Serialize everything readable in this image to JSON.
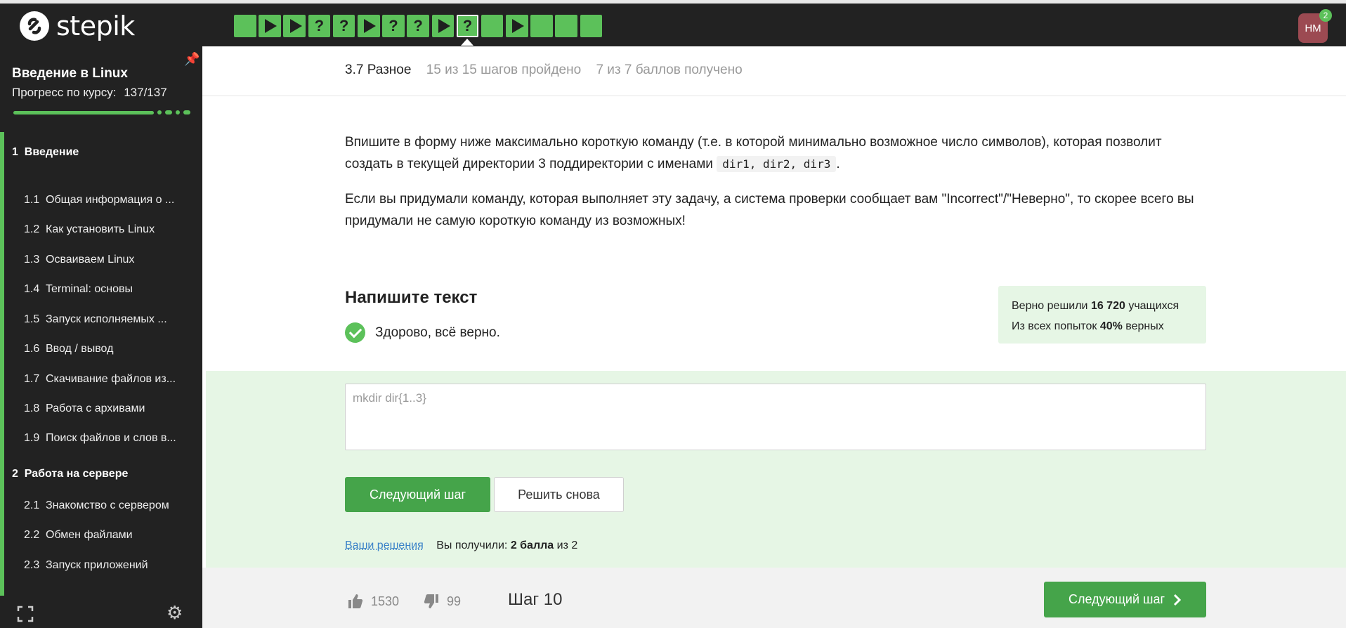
{
  "app": {
    "logo_text": "stepik"
  },
  "steps": [
    {
      "type": "done"
    },
    {
      "type": "video"
    },
    {
      "type": "video"
    },
    {
      "type": "quiz"
    },
    {
      "type": "quiz"
    },
    {
      "type": "video"
    },
    {
      "type": "quiz"
    },
    {
      "type": "quiz"
    },
    {
      "type": "video"
    },
    {
      "type": "quiz",
      "active": true
    },
    {
      "type": "done"
    },
    {
      "type": "video"
    },
    {
      "type": "done"
    },
    {
      "type": "done"
    },
    {
      "type": "done"
    }
  ],
  "user": {
    "initials": "НМ",
    "notifications": "2"
  },
  "sidebar": {
    "course_title": "Введение в Linux",
    "progress_label": "Прогресс по курсу:",
    "progress_value": "137/137",
    "sections": [
      {
        "num": "1",
        "title": "Введение"
      },
      {
        "num": "2",
        "title": "Работа на сервере"
      }
    ],
    "lessons": [
      {
        "num": "1.1",
        "title": "Общая информация о ..."
      },
      {
        "num": "1.2",
        "title": "Как установить Linux"
      },
      {
        "num": "1.3",
        "title": "Осваиваем Linux"
      },
      {
        "num": "1.4",
        "title": "Terminal: основы"
      },
      {
        "num": "1.5",
        "title": "Запуск исполняемых ..."
      },
      {
        "num": "1.6",
        "title": "Ввод / вывод"
      },
      {
        "num": "1.7",
        "title": "Скачивание файлов из..."
      },
      {
        "num": "1.8",
        "title": "Работа с архивами"
      },
      {
        "num": "1.9",
        "title": "Поиск файлов и слов в..."
      },
      {
        "num": "2.1",
        "title": "Знакомство с сервером"
      },
      {
        "num": "2.2",
        "title": "Обмен файлами"
      },
      {
        "num": "2.3",
        "title": "Запуск приложений"
      }
    ]
  },
  "header": {
    "lesson": "3.7 Разное",
    "steps_passed": "15 из 15 шагов пройдено",
    "points": "7 из 7 баллов  получено"
  },
  "content": {
    "p1_before": "Впишите в форму ниже максимально короткую команду (т.е. в которой минимально возможное число символов), которая позволит создать в текущей директории 3 поддиректории с именами ",
    "p1_code": "dir1, dir2, dir3",
    "p1_after": ".",
    "p2": "Если вы придумали команду, которая выполняет эту задачу, а система проверки сообщает вам \"Incorrect\"/\"Неверно\", то скорее всего вы придумали не самую короткую команду из возможных!"
  },
  "task": {
    "title": "Напишите текст",
    "correct_msg": "Здорово, всё верно.",
    "stats_line1_a": "Верно решили ",
    "stats_line1_b": "16 720",
    "stats_line1_c": " учащихся",
    "stats_line2_a": "Из всех попыток ",
    "stats_line2_b": "40%",
    "stats_line2_c": " верных",
    "answer": "mkdir dir{1..3}",
    "next_button": "Следующий шаг",
    "retry_button": "Решить снова",
    "solutions_link": "Ваши решения",
    "score_a": "Вы получили: ",
    "score_b": "2 балла",
    "score_c": " из 2"
  },
  "footer": {
    "likes": "1530",
    "dislikes": "99",
    "step_label": "Шаг 10",
    "next_button": "Следующий шаг"
  },
  "colors": {
    "accent": "#5cc15a",
    "button": "#45a44a",
    "dark": "#222222",
    "success_bg": "#e6f6e5",
    "link": "#3b82c8"
  }
}
